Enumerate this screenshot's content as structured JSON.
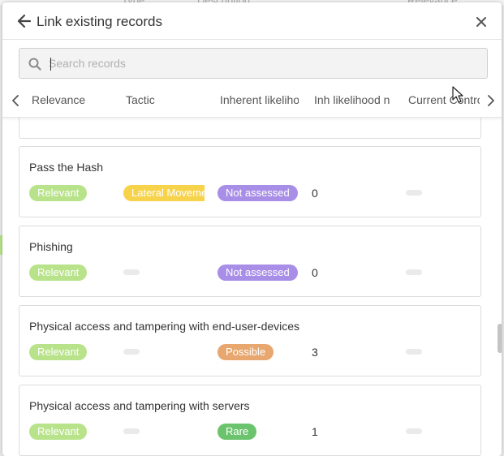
{
  "background": {
    "col_texts": [
      "Type",
      "Description",
      "Relevance"
    ]
  },
  "modal": {
    "title": "Link existing records",
    "icons": {
      "back": "arrow-left-icon",
      "close": "close-icon"
    }
  },
  "search": {
    "placeholder": "Search records",
    "value": "",
    "icon": "search-icon"
  },
  "columns": {
    "headers": [
      "Relevance",
      "Tactic",
      "Inherent likelihood",
      "Inh likelihood n",
      "Current Control"
    ],
    "left_icon": "chevron-left-icon",
    "right_icon": "chevron-right-icon"
  },
  "records": [
    {
      "name": "Pass the Hash",
      "relevance": "Relevant",
      "tactic": "Lateral Movement",
      "likelihood": "Not assessed",
      "likelihood_num": "0"
    },
    {
      "name": "Phishing",
      "relevance": "Relevant",
      "tactic": "",
      "likelihood": "Not assessed",
      "likelihood_num": "0"
    },
    {
      "name": "Physical access and tampering with end-user-devices",
      "relevance": "Relevant",
      "tactic": "",
      "likelihood": "Possible",
      "likelihood_num": "3"
    },
    {
      "name": "Physical access and tampering with servers",
      "relevance": "Relevant",
      "tactic": "",
      "likelihood": "Rare",
      "likelihood_num": "1"
    }
  ],
  "colors": {
    "relevant": "#b9e38a",
    "lateral_movement": "#f7d24b",
    "not_assessed": "#a88ee6",
    "possible": "#e8a76f",
    "rare": "#6bc46d"
  }
}
